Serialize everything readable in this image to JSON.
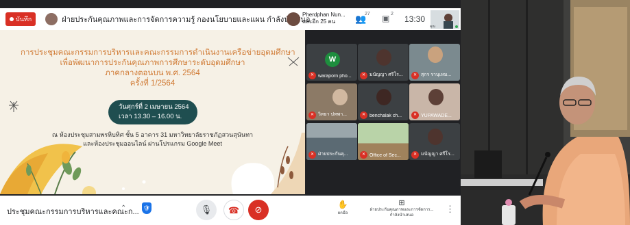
{
  "topbar": {
    "record_label": "บันทึก",
    "presenting_text": "ฝ่ายประกันคุณภาพและการจัดการความรู้ กองนโยบายและแผน กำลังนำเสนอ",
    "user_name": "Pherdphan Nun...",
    "user_sub": "และอีก 25 คน",
    "people_count": "27",
    "chat_count": "2",
    "time": "13:30",
    "self_label": "คุณ"
  },
  "slide": {
    "lines": [
      "การประชุมคณะกรรมการบริหารและคณะกรรมการดำเนินงานเครือข่ายอุดมศึกษา",
      "เพื่อพัฒนาการประกันคุณภาพการศึกษาระดับอุดมศึกษา",
      "ภาคกลางตอนบน พ.ศ. 2564",
      "ครั้งที่ 1/2564"
    ],
    "date_line1": "วันศุกร์ที่ 2 เมษายน 2564",
    "date_line2": "เวลา 13.30 – 16.00 น.",
    "venue_line1": "ณ ห้องประชุมสามพรหิบทิศ ชั้น 5 อาคาร 31 มหาวิทยาลัยราชภัฏสวนสุนันทา",
    "venue_line2": "และห้องประชุมออนไลน์ ผ่านโปรแกรม Google Meet"
  },
  "participants": [
    {
      "name": "waraporn pho...",
      "initial": "W"
    },
    {
      "name": "มนัญญา ศรีโร...",
      "initial": ""
    },
    {
      "name": "สุกร รานุเหม...",
      "initial": ""
    },
    {
      "name": "วิทยา ปทพา...",
      "initial": ""
    },
    {
      "name": "benchalak ch...",
      "initial": ""
    },
    {
      "name": "YUPAWADE...",
      "initial": ""
    },
    {
      "name": "ฝ่ายประกันคุ...",
      "initial": ""
    },
    {
      "name": "Office of Sec...",
      "initial": ""
    },
    {
      "name": "มนัญญา ศรีโร...",
      "initial": ""
    }
  ],
  "bottombar": {
    "meeting_title": "ประชุมคณะกรรมการบริหารและคณะก...",
    "raise_hand_label": "ยกมือ",
    "present_label": "ฝ่ายประกันคุณภาพและการจัดการ... กำลังนำเสนอ"
  },
  "colors": {
    "accent_red": "#d93025",
    "slide_title": "#d07a34",
    "pill": "#1f4e50",
    "meet_dark": "#202124"
  }
}
